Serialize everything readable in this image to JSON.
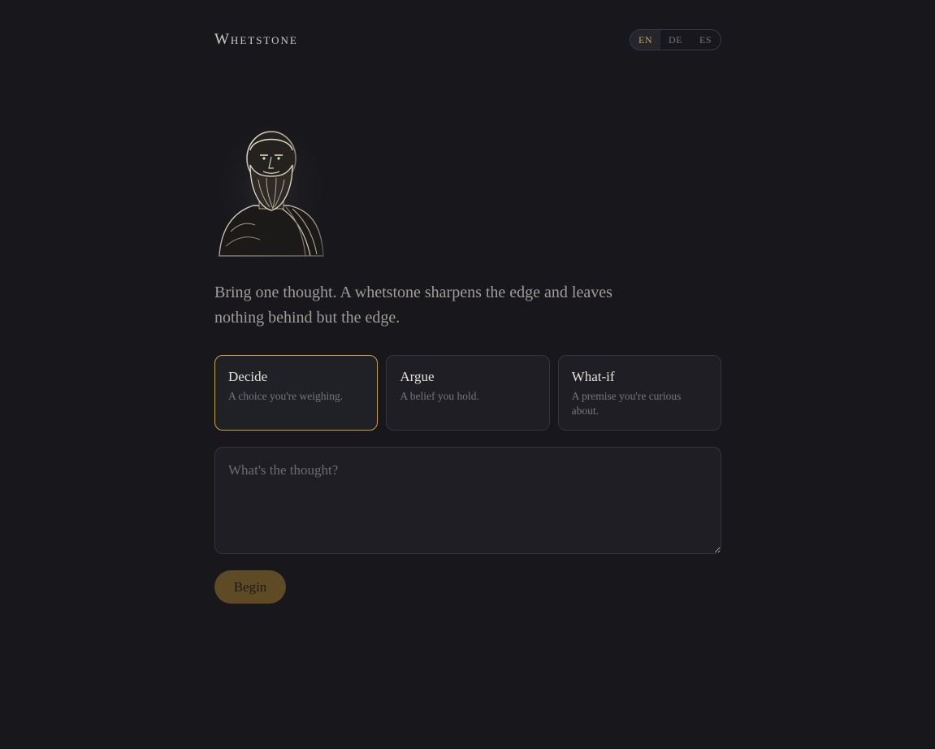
{
  "header": {
    "brand": "Whetstone",
    "languages": [
      {
        "code": "EN",
        "active": true
      },
      {
        "code": "DE",
        "active": false
      },
      {
        "code": "ES",
        "active": false
      }
    ]
  },
  "intro": {
    "tagline": "Bring one thought. A whetstone sharpens the edge and leaves nothing behind but the edge."
  },
  "modes": [
    {
      "title": "Decide",
      "description": "A choice you're weighing.",
      "selected": true
    },
    {
      "title": "Argue",
      "description": "A belief you hold.",
      "selected": false
    },
    {
      "title": "What-if",
      "description": "A premise you're curious about.",
      "selected": false
    }
  ],
  "input": {
    "placeholder": "What's the thought?",
    "value": ""
  },
  "actions": {
    "begin_label": "Begin"
  },
  "colors": {
    "background": "#17171c",
    "accent": "#c9a24a",
    "button": "#5e4a25"
  }
}
